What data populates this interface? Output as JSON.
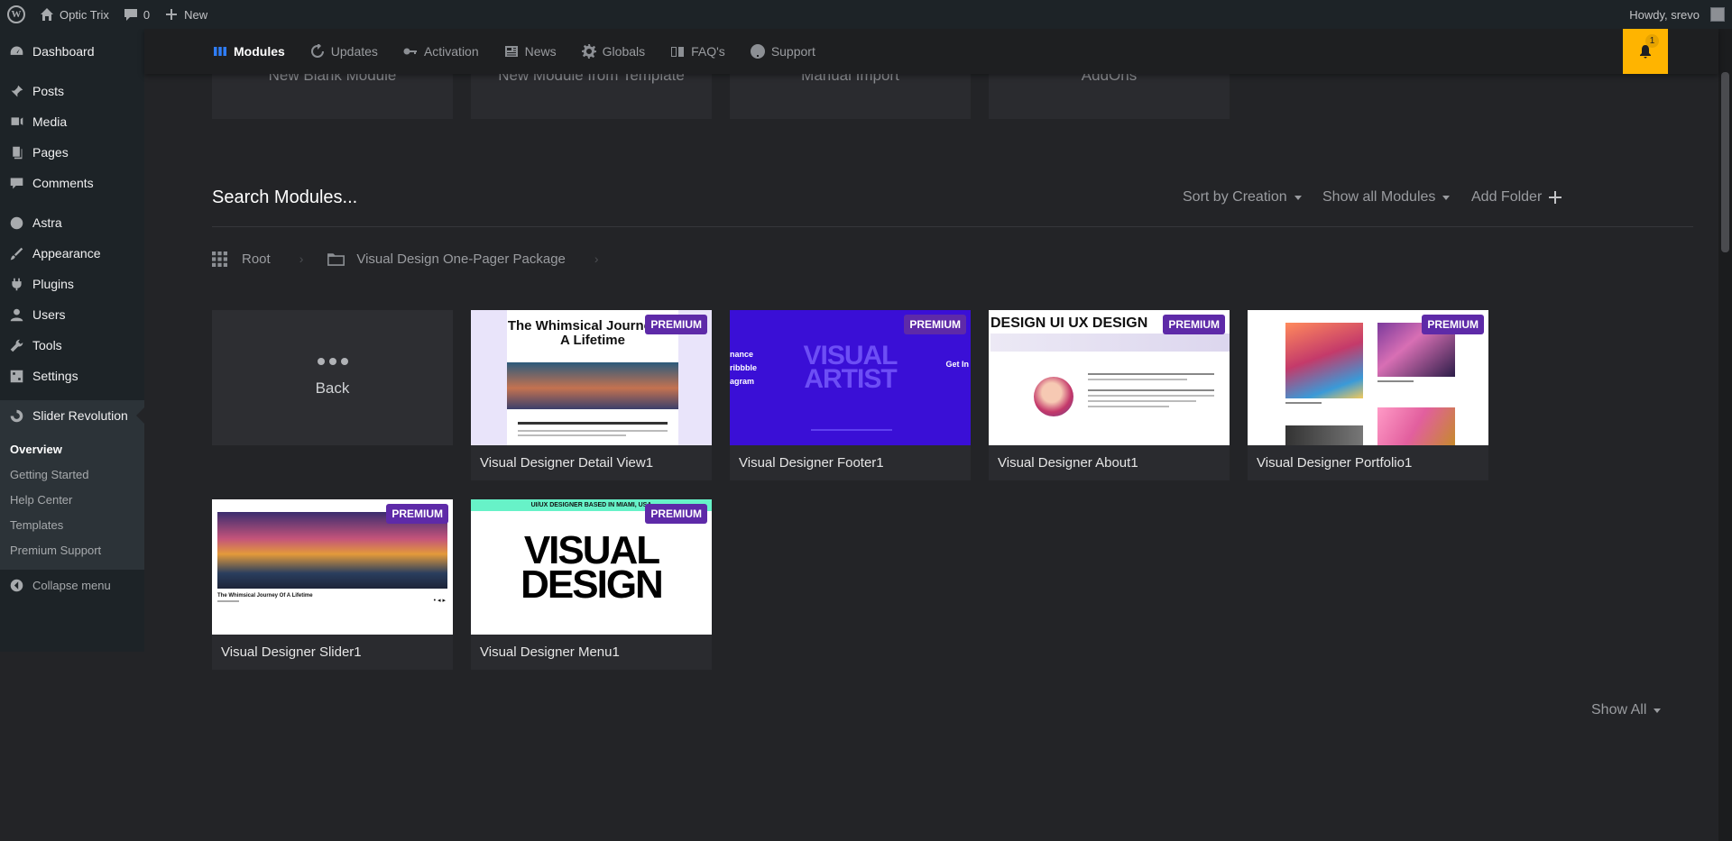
{
  "adminbar": {
    "site_name": "Optic Trix",
    "comments_count": "0",
    "new_label": "New",
    "howdy": "Howdy, srevo"
  },
  "sidebar": {
    "items": [
      {
        "label": "Dashboard",
        "icon": "dashboard-icon"
      },
      {
        "label": "Posts",
        "icon": "pin-icon"
      },
      {
        "label": "Media",
        "icon": "media-icon"
      },
      {
        "label": "Pages",
        "icon": "pages-icon"
      },
      {
        "label": "Comments",
        "icon": "comments-icon"
      },
      {
        "label": "Astra",
        "icon": "astra-icon"
      },
      {
        "label": "Appearance",
        "icon": "brush-icon"
      },
      {
        "label": "Plugins",
        "icon": "plug-icon"
      },
      {
        "label": "Users",
        "icon": "user-icon"
      },
      {
        "label": "Tools",
        "icon": "wrench-icon"
      },
      {
        "label": "Settings",
        "icon": "settings-icon"
      },
      {
        "label": "Slider Revolution",
        "icon": "slider-revolution-icon"
      }
    ],
    "submenu": [
      "Overview",
      "Getting Started",
      "Help Center",
      "Templates",
      "Premium Support"
    ],
    "collapse_label": "Collapse menu"
  },
  "topnav": {
    "items": [
      "Modules",
      "Updates",
      "Activation",
      "News",
      "Globals",
      "FAQ's",
      "Support"
    ],
    "notification_count": "1"
  },
  "top_cards": [
    "New Blank Module",
    "New Module from Template",
    "Manual Import",
    "AddOns"
  ],
  "search": {
    "title": "Search Modules...",
    "sort_label": "Sort by Creation",
    "filter_label": "Show all Modules",
    "add_folder_label": "Add Folder"
  },
  "breadcrumb": {
    "root": "Root",
    "folder": "Visual Design One-Pager Package"
  },
  "back_label": "Back",
  "badge_label": "PREMIUM",
  "modules": [
    {
      "name": "Visual Designer Detail View1",
      "thumb_title": "The Whimsical Journey Of A Lifetime"
    },
    {
      "name": "Visual Designer Footer1",
      "thumb_title": "VISUAL ARTIST"
    },
    {
      "name": "Visual Designer About1",
      "thumb_title": "DESIGN UI UX DESIGN"
    },
    {
      "name": "Visual Designer Portfolio1",
      "thumb_title": ""
    },
    {
      "name": "Visual Designer Slider1",
      "thumb_title": "The Whimsical Journey Of A Lifetime"
    },
    {
      "name": "Visual Designer Menu1",
      "thumb_title": "VISUAL DESIGN",
      "thumb_top": "UI/UX DESIGNER BASED IN MIAMI, USA"
    }
  ],
  "show_all_label": "Show All",
  "colors": {
    "accent_blue": "#2f7df6",
    "notification": "#ffb400",
    "premium_badge": "#5e2aa8"
  }
}
